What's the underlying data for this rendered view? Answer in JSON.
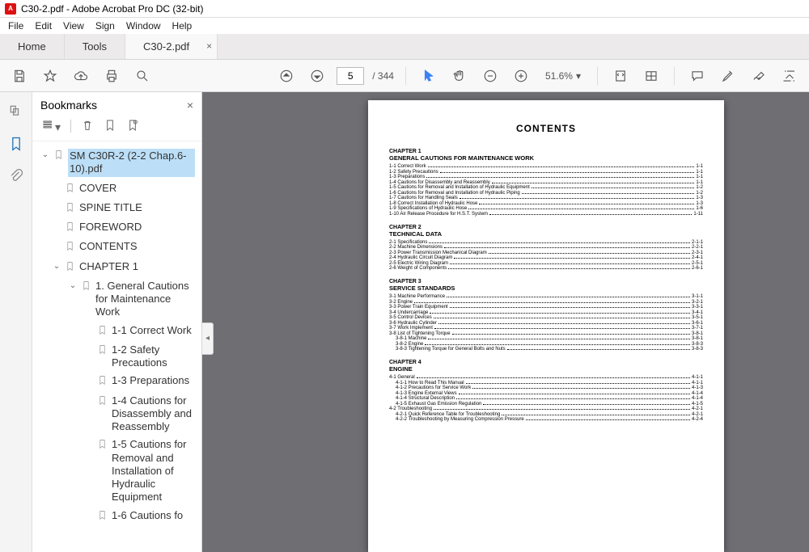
{
  "window": {
    "title": "C30-2.pdf - Adobe Acrobat Pro DC (32-bit)"
  },
  "menu": {
    "file": "File",
    "edit": "Edit",
    "view": "View",
    "sign": "Sign",
    "window": "Window",
    "help": "Help"
  },
  "tabs": {
    "home": "Home",
    "tools": "Tools",
    "doc": "C30-2.pdf"
  },
  "toolbar": {
    "page_current": "5",
    "page_total": "/ 344",
    "zoom": "51.6%"
  },
  "sidepanel": {
    "title": "Bookmarks"
  },
  "bookmarks": {
    "root": "SM C30R-2 (2-2 Chap.6-10).pdf",
    "l1_cover": "COVER",
    "l1_spine": "SPINE TITLE",
    "l1_foreword": "FOREWORD",
    "l1_contents": "CONTENTS",
    "l1_chapter1": "CHAPTER 1",
    "l2_general": "1. General Cautions for Maintenance Work",
    "l3_11": "1-1 Correct Work",
    "l3_12": "1-2 Safety Precautions",
    "l3_13": "1-3 Preparations",
    "l3_14": "1-4 Cautions for Disassembly and Reassembly",
    "l3_15": "1-5 Cautions for Removal and Installation of Hydraulic Equipment",
    "l3_16": "1-6 Cautions fo"
  },
  "doc": {
    "title": "CONTENTS",
    "ch1_label": "CHAPTER 1",
    "ch1_title": "GENERAL CAUTIONS FOR MAINTENANCE WORK",
    "ch1_items": [
      {
        "t": "1-1 Correct Work",
        "p": "1-1"
      },
      {
        "t": "1-2 Safety Precautions",
        "p": "1-1"
      },
      {
        "t": "1-3 Preparations",
        "p": "1-1"
      },
      {
        "t": "1-4 Cautions for Disassembly and Reassembly",
        "p": "1-1"
      },
      {
        "t": "1-5 Cautions for Removal and Installation of Hydraulic Equipment",
        "p": "1-2"
      },
      {
        "t": "1-6 Cautions for Removal and Installation of Hydraulic Piping",
        "p": "1-2"
      },
      {
        "t": "1-7 Cautions for Handling Seals",
        "p": "1-3"
      },
      {
        "t": "1-8 Correct Installation of Hydraulic Hose",
        "p": "1-3"
      },
      {
        "t": "1-9 Specifications of Hydraulic Hose",
        "p": "1-6"
      },
      {
        "t": "1-10 Air Release Procedure for H.S.T. System",
        "p": "1-11"
      }
    ],
    "ch2_label": "CHAPTER 2",
    "ch2_title": "TECHNICAL DATA",
    "ch2_items": [
      {
        "t": "2-1 Specifications",
        "p": "2-1-1"
      },
      {
        "t": "2-2 Machine Dimensions",
        "p": "2-2-1"
      },
      {
        "t": "2-3 Power Transmission Mechanical Diagram",
        "p": "2-3-1"
      },
      {
        "t": "2-4 Hydraulic Circuit Diagram",
        "p": "2-4-1"
      },
      {
        "t": "2-5 Electric Wiring Diagram",
        "p": "2-5-1"
      },
      {
        "t": "2-6 Weight of Components",
        "p": "2-6-1"
      }
    ],
    "ch3_label": "CHAPTER 3",
    "ch3_title": "SERVICE STANDARDS",
    "ch3_items": [
      {
        "t": "3-1 Machine Performance",
        "p": "3-1-1"
      },
      {
        "t": "3-2 Engine",
        "p": "3-2-1"
      },
      {
        "t": "3-3 Power Train Equipment",
        "p": "3-3-1"
      },
      {
        "t": "3-4 Undercarriage",
        "p": "3-4-1"
      },
      {
        "t": "3-5 Control Devices",
        "p": "3-5-1"
      },
      {
        "t": "3-6 Hydraulic Cylinder",
        "p": "3-6-1"
      },
      {
        "t": "3-7 Work Implement",
        "p": "3-7-1"
      },
      {
        "t": "3-8 List of Tightening Torque",
        "p": "3-8-1"
      },
      {
        "t": "3-8-1 Machine",
        "p": "3-8-1",
        "ind": 1
      },
      {
        "t": "3-8-2 Engine",
        "p": "3-8-3",
        "ind": 1
      },
      {
        "t": "3-8-3 Tightening Torque for General Bolts and Nuts",
        "p": "3-8-3",
        "ind": 1
      }
    ],
    "ch4_label": "CHAPTER 4",
    "ch4_title": "ENGINE",
    "ch4_items": [
      {
        "t": "4-1 General",
        "p": "4-1-1"
      },
      {
        "t": "4-1-1 How to Read This Manual",
        "p": "4-1-1",
        "ind": 1
      },
      {
        "t": "4-1-2 Precautions for Service Work",
        "p": "4-1-3",
        "ind": 1
      },
      {
        "t": "4-1-3  Engine External Views",
        "p": "4-1-4",
        "ind": 1
      },
      {
        "t": "4-1-4  Structural Description",
        "p": "4-1-4",
        "ind": 1
      },
      {
        "t": "4-1-5 Exhaust Gas Emission Regulation",
        "p": "4-1-5",
        "ind": 1
      },
      {
        "t": "4-2 Troubleshooting",
        "p": "4-2-1"
      },
      {
        "t": "4-2-1 Quick Reference Table for Troubleshooting",
        "p": "4-2-1",
        "ind": 1
      },
      {
        "t": "4-2-2 Troubleshooting by Measuring Compression Pressure",
        "p": "4-2-4",
        "ind": 1
      }
    ]
  }
}
